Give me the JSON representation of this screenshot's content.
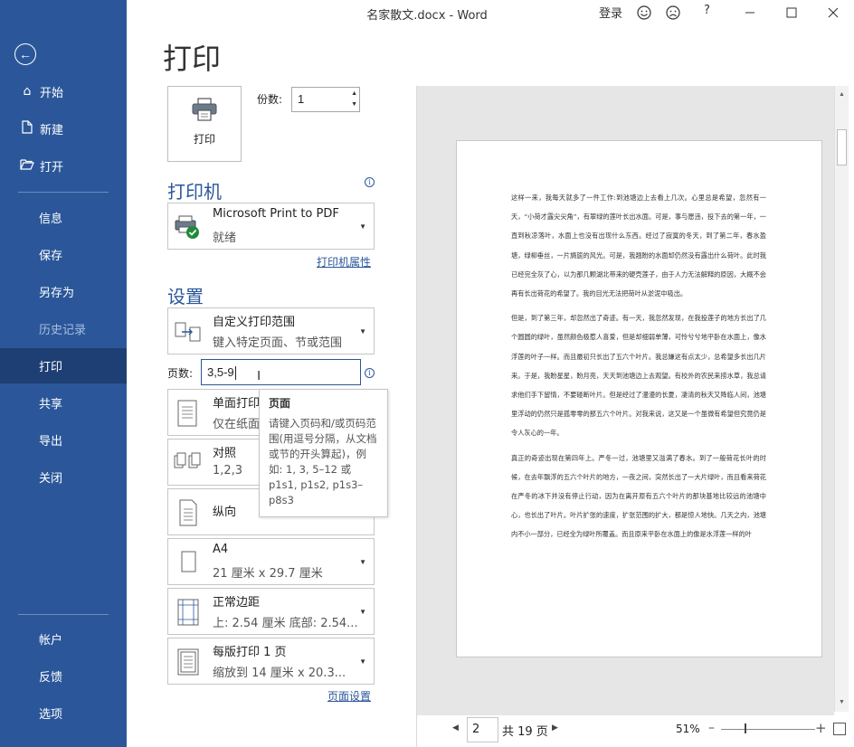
{
  "window": {
    "title": "名家散文.docx  -  Word",
    "signin": "登录",
    "help": "?"
  },
  "sidebar": {
    "items_top": [
      {
        "label": "开始",
        "icon": "home-icon"
      },
      {
        "label": "新建",
        "icon": "new-document-icon"
      },
      {
        "label": "打开",
        "icon": "folder-open-icon"
      }
    ],
    "items_mid": [
      {
        "label": "信息"
      },
      {
        "label": "保存"
      },
      {
        "label": "另存为"
      },
      {
        "label": "历史记录"
      },
      {
        "label": "打印"
      },
      {
        "label": "共享"
      },
      {
        "label": "导出"
      },
      {
        "label": "关闭"
      }
    ],
    "items_bottom": [
      {
        "label": "帐户"
      },
      {
        "label": "反馈"
      },
      {
        "label": "选项"
      }
    ]
  },
  "main": {
    "heading": "打印",
    "print_button": "打印",
    "copies_label": "份数:",
    "copies_value": "1",
    "printer_section": "打印机",
    "printer": {
      "name": "Microsoft Print to PDF",
      "status": "就绪"
    },
    "printer_properties": "打印机属性",
    "settings_section": "设置",
    "range": {
      "title": "自定义打印范围",
      "desc": "键入特定页面、节或范围"
    },
    "pages_label": "页数:",
    "pages_value": "3,5-9",
    "sides": {
      "title": "单面打印",
      "desc": "仅在纸面"
    },
    "collate": {
      "title": "对照",
      "desc": "1,2,3"
    },
    "orientation": {
      "title": "纵向"
    },
    "paper": {
      "title": "A4",
      "desc": "21 厘米 x 29.7 厘米"
    },
    "margins": {
      "title": "正常边距",
      "desc": "上: 2.54 厘米 底部: 2.54..."
    },
    "per_sheet": {
      "title": "每版打印 1 页",
      "desc": "缩放到 14 厘米 x 20.3..."
    },
    "page_setup": "页面设置"
  },
  "tooltip": {
    "title": "页面",
    "body": "请键入页码和/或页码范围(用逗号分隔，从文档或节的开头算起)，例如: 1, 3, 5–12 或 p1s1, p1s2, p1s3–p8s3"
  },
  "preview": {
    "paragraphs": [
      "这样一来，我每天就多了一件工作:到池塘边上去看上几次。心里总是希望，忽然有一天，“小荷才露尖尖角”，有翠绿的莲叶长出水面。可是，事与愿违，投下去的第一年，一直到秋凉落叶，水面上也没有出现什么东西。经过了寂寞的冬天，到了第二年，春水盈塘，绿柳垂丝，一片旖旎的风光。可是，我翘盼的水面却仍然没有露出什么荷叶。此时我已经完全灰了心，以为那几颗湖北带来的硬壳莲子，由于人力无法解释的原因，大概不会再有长出荷花的希望了。我的目光无法把荷叶从淤泥中吸出。",
      "但是，到了第三年，却忽然出了奇迹。有一天，我忽然发现，在我投莲子的地方长出了几个圆圆的绿叶，虽然颜色极惹人喜爱，但是却细弱单薄，可怜兮兮地平卧在水面上，像水浮莲的叶子一样。而且最初只长出了五六个叶片。我总嫌这有点太少，总希望多长出几片来。于是，我盼星星，盼月亮，天天到池塘边上去观望。有校外的农民来捞水草，我总请求他们手下留情，不要碰断叶片。但是经过了漫漫的长夏，凄清的秋天又降临人间，池塘里浮动的仍然只是孤零零的那五六个叶片。对我来说，这又是一个虽微有希望但究竟仍是令人灰心的一年。",
      "真正的奇迹出现在第四年上。严冬一过，池塘里又溢满了春水。到了一般荷花长叶的时候，在去年飘浮的五六个叶片的地方，一夜之间，突然长出了一大片绿叶，而且看来荷花在严冬的冰下并没有停止行动，因为在离开原有五六个叶片的那块基地比较远的池塘中心，也长出了叶片。叶片扩张的速度，扩张范围的扩大，都是惊人地快。几天之内，池塘内不小一部分，已经全为绿叶所覆盖。而且原来平卧在水面上的像是水浮莲一样的叶"
    ],
    "current_page": "2",
    "total_pages": "共 19 页",
    "zoom": "51%"
  }
}
